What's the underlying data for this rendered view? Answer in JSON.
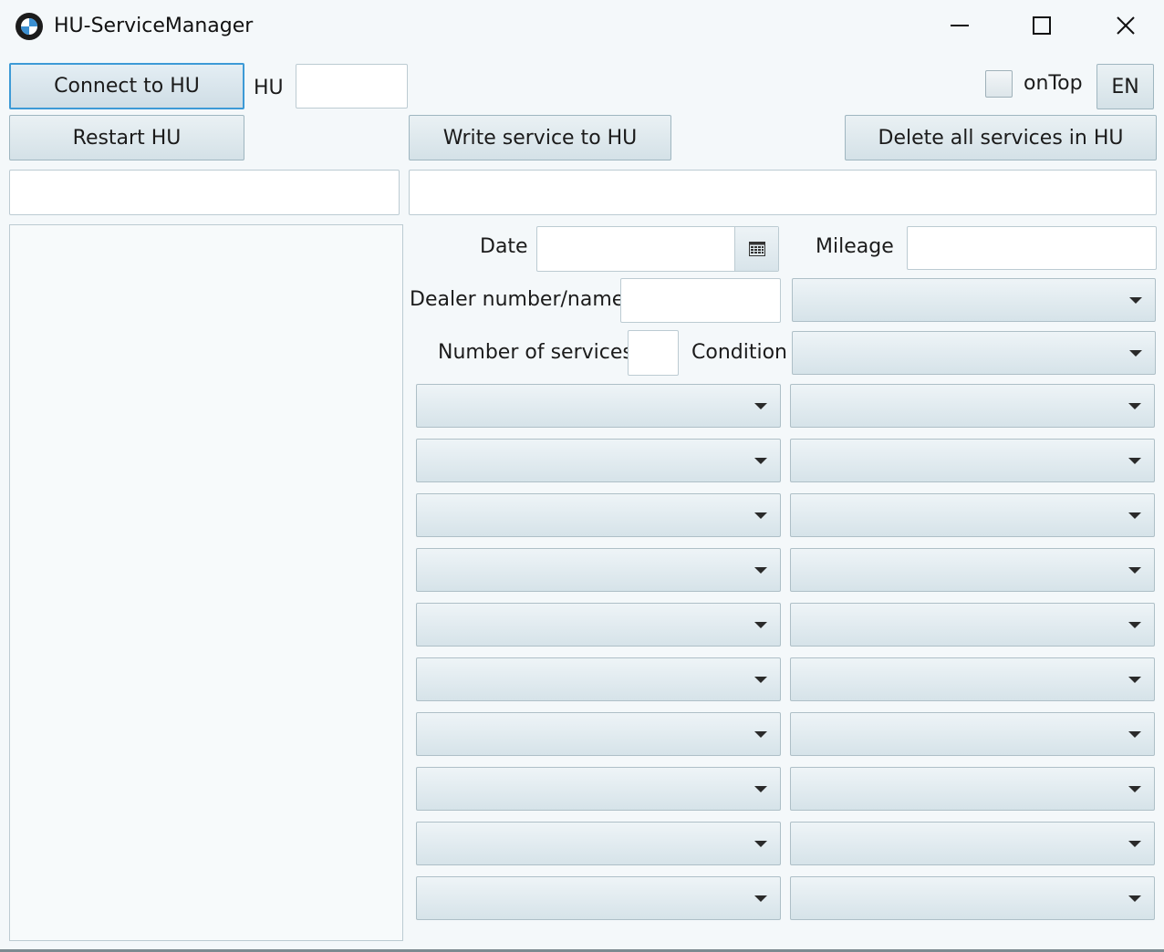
{
  "window": {
    "title": "HU-ServiceManager",
    "icon": "bmw-logo-icon",
    "controls": [
      "minimize-icon",
      "maximize-icon",
      "close-icon"
    ]
  },
  "toolbar": {
    "connect_label": "Connect to HU",
    "hu_label": "HU",
    "hu_value": "",
    "ontop_label": "onTop",
    "ontop_checked": false,
    "language_label": "EN",
    "restart_label": "Restart HU",
    "write_label": "Write service to HU",
    "delete_label": "Delete all services in HU"
  },
  "status": {
    "left_value": "",
    "right_value": ""
  },
  "form": {
    "date_label": "Date",
    "date_value": "",
    "calendar_icon": "calendar-icon",
    "mileage_label": "Mileage",
    "mileage_value": "",
    "dealer_label": "Dealer number/name",
    "dealer_value": "",
    "dealer_select_value": "",
    "services_count_label": "Number of services",
    "services_count_value": "",
    "condition_label": "Condition",
    "condition_value": ""
  },
  "service_rows": 10,
  "colors": {
    "background": "#f4f8fa",
    "focus_border": "#3d9ad6",
    "control_border": "#9fb6c0"
  }
}
